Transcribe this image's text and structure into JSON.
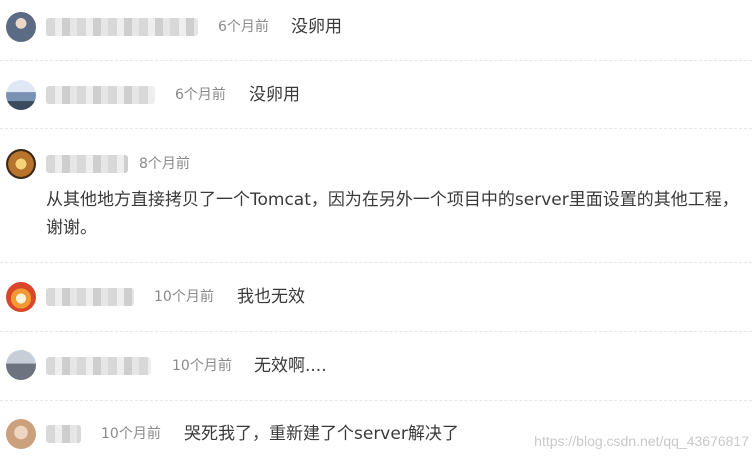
{
  "comments": [
    {
      "time": "6个月前",
      "text": "没卵用"
    },
    {
      "time": "6个月前",
      "text": "没卵用"
    },
    {
      "time": "8个月前",
      "text_line1": "从其他地方直接拷贝了一个Tomcat，因为在另外一个项目中的server里面设置的其他工程，",
      "text_line2": "谢谢。"
    },
    {
      "time": "10个月前",
      "text": "我也无效"
    },
    {
      "time": "10个月前",
      "text": "无效啊...."
    },
    {
      "time": "10个月前",
      "text": "哭死我了，重新建了个server解决了"
    }
  ],
  "watermark": "https://blog.csdn.net/qq_43676817",
  "avatar_colors": [
    "#5b6b84",
    "#7b93b2",
    "#b9742b",
    "#d9462a",
    "#6d7480",
    "#caa07d"
  ]
}
